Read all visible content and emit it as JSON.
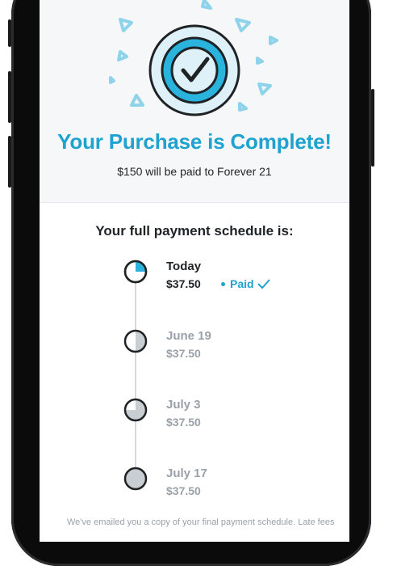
{
  "header": {
    "title": "Your Purchase is Complete!",
    "subtitle": "$150 will be paid to Forever 21"
  },
  "schedule": {
    "title": "Your full payment schedule is:",
    "items": [
      {
        "date": "Today",
        "amount": "$37.50",
        "status": "Paid",
        "fraction_paid": 0.25
      },
      {
        "date": "June 19",
        "amount": "$37.50",
        "fraction_paid": 0.5
      },
      {
        "date": "July 3",
        "amount": "$37.50",
        "fraction_paid": 0.75
      },
      {
        "date": "July 17",
        "amount": "$37.50",
        "fraction_paid": 1.0
      }
    ]
  },
  "footer": {
    "text": "We've emailed you a copy of your final payment schedule. Late fees"
  },
  "colors": {
    "accent": "#1fa2cf",
    "text": "#1f2326",
    "muted": "#9aa1a8",
    "pie_fill": "#c9ced3"
  },
  "icons": [
    "checkmark-badge-icon",
    "check-icon",
    "confetti-icon"
  ]
}
